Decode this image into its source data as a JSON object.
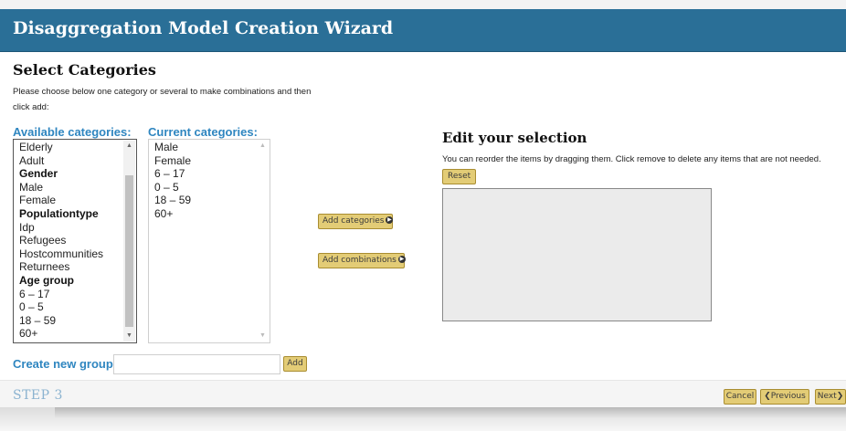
{
  "window": {
    "title": "Disaggregation Model Creation Wizard"
  },
  "section": {
    "title": "Select Categories",
    "instructions": "Please choose below one category or several to make combinations and then click add:"
  },
  "available": {
    "label": "Available categories:",
    "items": [
      {
        "text": "Elderly",
        "group": false
      },
      {
        "text": "Adult",
        "group": false
      },
      {
        "text": "Gender",
        "group": true
      },
      {
        "text": "Male",
        "group": false
      },
      {
        "text": "Female",
        "group": false
      },
      {
        "text": "Populationtype",
        "group": true
      },
      {
        "text": "Idp",
        "group": false
      },
      {
        "text": "Refugees",
        "group": false
      },
      {
        "text": "Hostcommunities",
        "group": false
      },
      {
        "text": "Returnees",
        "group": false
      },
      {
        "text": "Age group",
        "group": true
      },
      {
        "text": "6 – 17",
        "group": false
      },
      {
        "text": "0 – 5",
        "group": false
      },
      {
        "text": "18 – 59",
        "group": false
      },
      {
        "text": "60+",
        "group": false
      }
    ]
  },
  "current": {
    "label": "Current categories:",
    "items": [
      "Male",
      "Female",
      "6 – 17",
      "0 – 5",
      "18 – 59",
      "60+"
    ]
  },
  "actions": {
    "add_categories": "Add categories",
    "add_combinations": "Add combinations"
  },
  "edit": {
    "title": "Edit your selection",
    "description": "You can reorder the items by dragging them. Click remove to delete any items that are not needed.",
    "reset_label": "Reset"
  },
  "new_group": {
    "label": "Create new group:",
    "value": "",
    "placeholder": "",
    "add_label": "Add"
  },
  "footer": {
    "step": "STEP 3",
    "cancel": "Cancel",
    "previous": "❮Previous",
    "next": "Next❯"
  },
  "colors": {
    "title_bar": "#2a6f97",
    "label_blue": "#2f86c0",
    "button_gold": "#e3cc76",
    "step_text": "#8bb3d0"
  }
}
